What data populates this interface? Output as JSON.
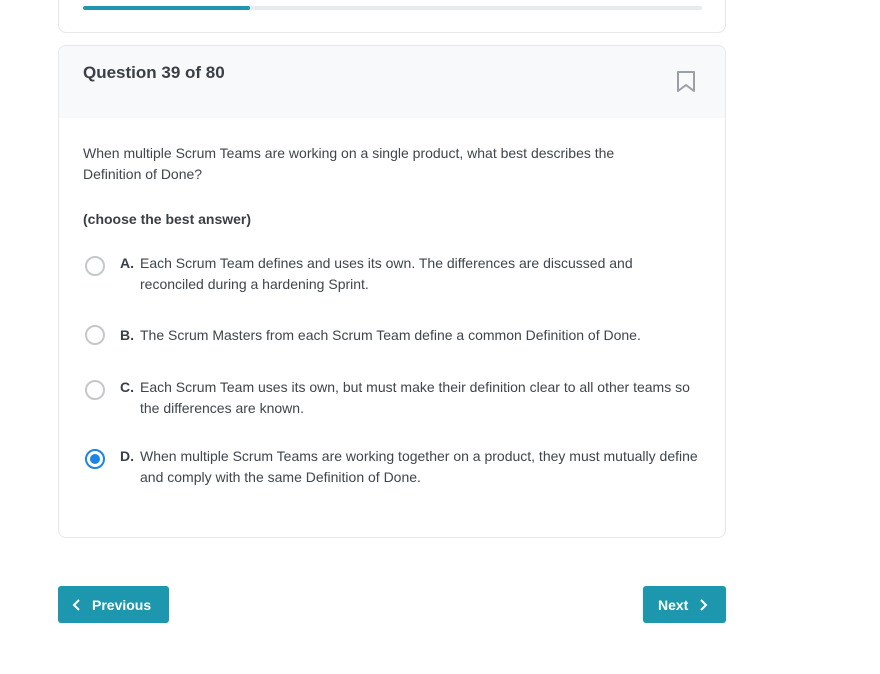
{
  "progress": {
    "fraction": 0.27
  },
  "question": {
    "title": "Question 39 of 80",
    "text": "When multiple Scrum Teams are working on a single product, what best describes the Definition of Done?",
    "instruction": "(choose the best answer)",
    "options": [
      {
        "letter": "A.",
        "text": "Each Scrum Team defines and uses its own. The differences are discussed and reconciled during a hardening Sprint.",
        "selected": false
      },
      {
        "letter": "B.",
        "text": "The Scrum Masters from each Scrum Team define a common Definition of Done.",
        "selected": false
      },
      {
        "letter": "C.",
        "text": "Each Scrum Team uses its own, but must make their definition clear to all other teams so the differences are known.",
        "selected": false
      },
      {
        "letter": "D.",
        "text": "When multiple Scrum Teams are working together on a product, they must mutually define and comply with the same Definition of Done.",
        "selected": true
      }
    ]
  },
  "nav": {
    "previous_label": "Previous",
    "next_label": "Next"
  },
  "icons": {
    "bookmark": "bookmark-icon",
    "prev": "chevron-left-icon",
    "next": "chevron-right-icon"
  },
  "colors": {
    "accent": "#1d97ad",
    "progress": "#1f95b0",
    "radio_selected": "#1a84e8"
  }
}
